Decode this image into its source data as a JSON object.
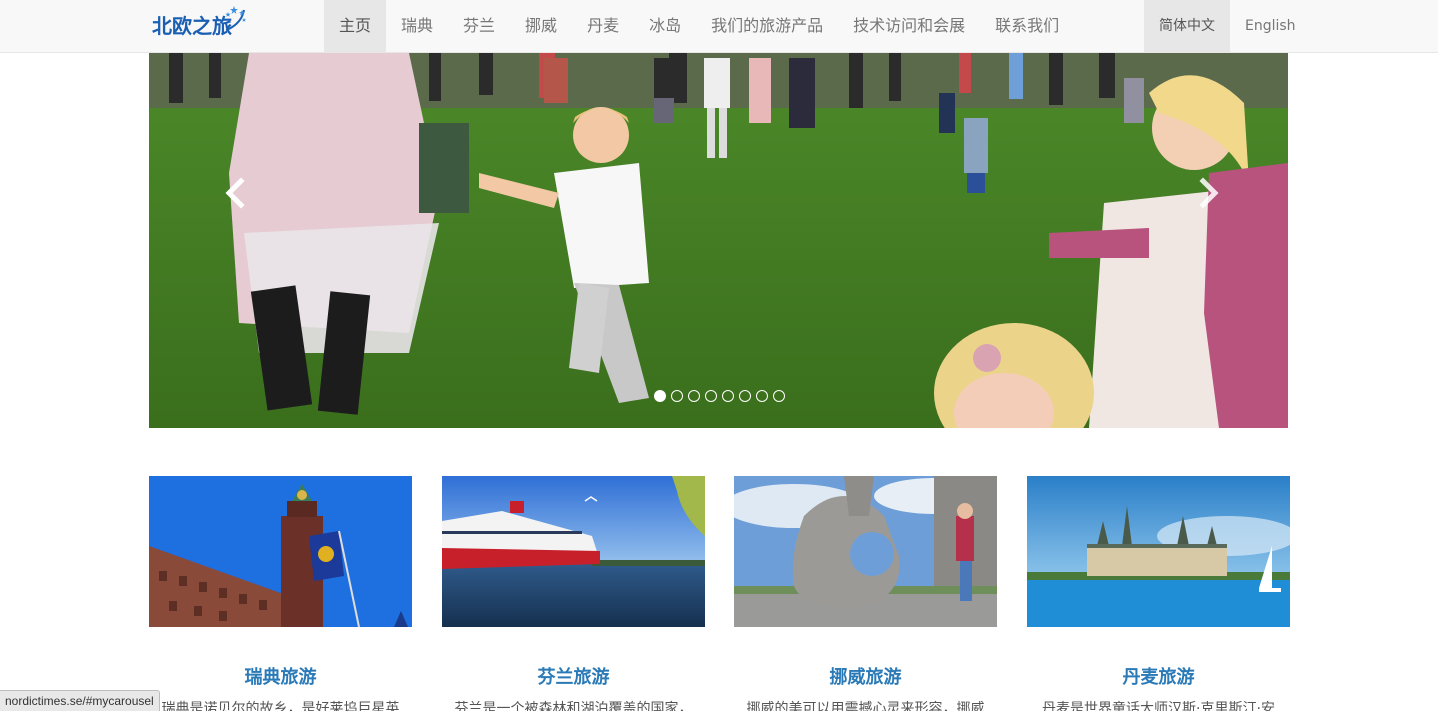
{
  "navbar": {
    "logo_text": "北欧之旅",
    "menu": [
      {
        "label": "主页",
        "active": true
      },
      {
        "label": "瑞典",
        "active": false
      },
      {
        "label": "芬兰",
        "active": false
      },
      {
        "label": "挪威",
        "active": false
      },
      {
        "label": "丹麦",
        "active": false
      },
      {
        "label": "冰岛",
        "active": false
      },
      {
        "label": "我们的旅游产品",
        "active": false
      },
      {
        "label": "技术访问和会展",
        "active": false
      },
      {
        "label": "联系我们",
        "active": false
      }
    ],
    "languages": [
      {
        "label": "简体中文",
        "active": true
      },
      {
        "label": "English",
        "active": false
      }
    ]
  },
  "carousel": {
    "slide_count": 8,
    "active_index": 0
  },
  "cards": [
    {
      "title": "瑞典旅游",
      "desc": "瑞典是诺贝尔的故乡，是好莱坞巨星英"
    },
    {
      "title": "芬兰旅游",
      "desc": "芬兰是一个被森林和湖泊覆盖的国家，"
    },
    {
      "title": "挪威旅游",
      "desc": "挪威的美可以用震撼心灵来形容，挪威"
    },
    {
      "title": "丹麦旅游",
      "desc": "丹麦是世界童话大师汉斯·克里斯汀·安"
    }
  ],
  "statusbar": {
    "url": "nordictimes.se/#mycarousel"
  },
  "colors": {
    "navbar_bg": "#f8f8f8",
    "active_nav_bg": "#e7e7e7",
    "card_title": "#2a7ab8",
    "logo": "#1a5fb4"
  }
}
